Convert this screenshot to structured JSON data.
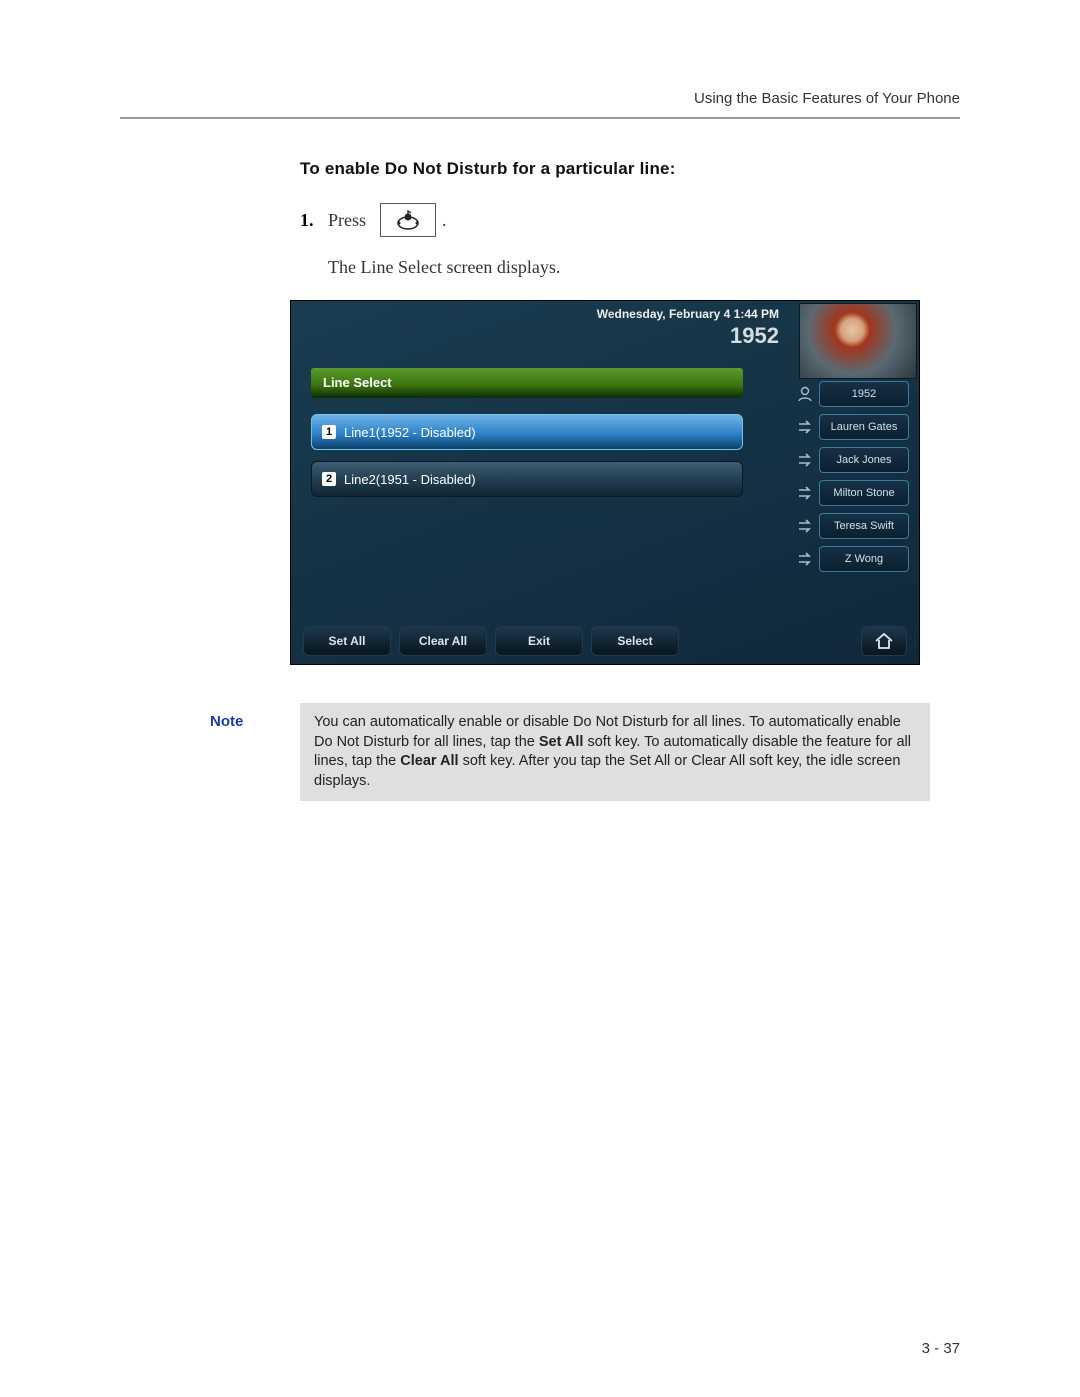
{
  "header": {
    "section": "Using the Basic Features of Your Phone"
  },
  "heading": "To enable Do Not Disturb for a particular line:",
  "step": {
    "number": "1.",
    "verb": "Press",
    "period": ".",
    "desc": "The Line Select screen displays."
  },
  "phone": {
    "datetime": "Wednesday, February 4  1:44 PM",
    "extension": "1952",
    "titlebar": "Line Select",
    "lines": [
      {
        "badge": "1",
        "label": "Line1(1952 - Disabled)"
      },
      {
        "badge": "2",
        "label": "Line2(1951 - Disabled)"
      }
    ],
    "contacts": [
      "1952",
      "Lauren Gates",
      "Jack Jones",
      "Milton Stone",
      "Teresa Swift",
      "Z Wong"
    ],
    "softkeys": [
      "Set All",
      "Clear All",
      "Exit",
      "Select"
    ]
  },
  "note": {
    "label": "Note",
    "text_pre": "You can automatically enable or disable Do Not Disturb for all lines. To automatically enable Do Not Disturb for all lines, tap the ",
    "bold1": "Set All",
    "text_mid": " soft key. To automatically disable the feature for all lines, tap the ",
    "bold2": "Clear All",
    "text_post": " soft key. After you tap the Set All or Clear All soft key, the idle screen displays."
  },
  "footer": {
    "page": "3 - 37"
  }
}
